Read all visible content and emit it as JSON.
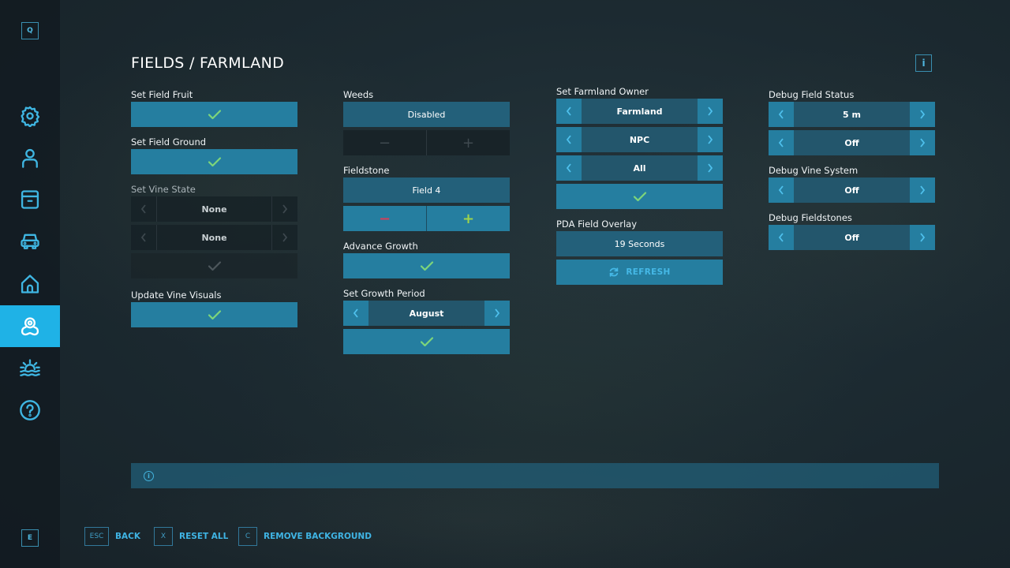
{
  "sidebar": {
    "top_key": "Q",
    "bottom_key": "E",
    "items": [
      {
        "icon": "gear-icon",
        "label": "Settings",
        "active": false
      },
      {
        "icon": "user-icon",
        "label": "Player",
        "active": false
      },
      {
        "icon": "archive-box-icon",
        "label": "Storage",
        "active": false
      },
      {
        "icon": "vehicle-icon",
        "label": "Vehicles",
        "active": false
      },
      {
        "icon": "home-icon",
        "label": "Placeables",
        "active": false
      },
      {
        "icon": "map-pin-icon",
        "label": "Fields / Farmland",
        "active": true
      },
      {
        "icon": "sunrise-water-icon",
        "label": "Environment",
        "active": false
      },
      {
        "icon": "help-icon",
        "label": "Help",
        "active": false
      }
    ]
  },
  "header": {
    "title": "FIELDS / FARMLAND",
    "info_icon_glyph": "i"
  },
  "columns": {
    "col1": {
      "set_field_fruit": {
        "label": "Set Field Fruit"
      },
      "set_field_ground": {
        "label": "Set Field Ground"
      },
      "set_vine_state": {
        "label": "Set Vine State",
        "selector1": "None",
        "selector2": "None"
      },
      "update_vine_visuals": {
        "label": "Update Vine Visuals"
      }
    },
    "col2": {
      "weeds": {
        "label": "Weeds",
        "value": "Disabled",
        "minus": "−",
        "plus": "+"
      },
      "fieldstone": {
        "label": "Fieldstone",
        "value": "Field 4",
        "minus": "−",
        "plus": "+"
      },
      "advance_growth": {
        "label": "Advance Growth"
      },
      "set_growth_period": {
        "label": "Set Growth Period",
        "value": "August"
      }
    },
    "col3": {
      "set_farmland_owner": {
        "label": "Set Farmland Owner",
        "selector1": "Farmland",
        "selector2": "NPC",
        "selector3": "All"
      },
      "pda_field_overlay": {
        "label": "PDA Field Overlay",
        "value": "19 Seconds",
        "refresh_label": "REFRESH"
      }
    },
    "col4": {
      "debug_field_status": {
        "label": "Debug Field Status",
        "selector1": "5 m",
        "selector2": "Off"
      },
      "debug_vine_system": {
        "label": "Debug Vine System",
        "value": "Off"
      },
      "debug_fieldstones": {
        "label": "Debug Fieldstones",
        "value": "Off"
      }
    }
  },
  "info_bar": {
    "icon_glyph": "i",
    "text": ""
  },
  "footer": {
    "back": {
      "key": "ESC",
      "label": "BACK"
    },
    "reset_all": {
      "key": "X",
      "label": "RESET ALL"
    },
    "remove_background": {
      "key": "C",
      "label": "REMOVE BACKGROUND"
    }
  },
  "colors": {
    "accent": "#1fb2e6",
    "button": "#257ea0",
    "check": "#7ed67a",
    "minus": "#d1405a",
    "plus": "#9ed44c"
  }
}
